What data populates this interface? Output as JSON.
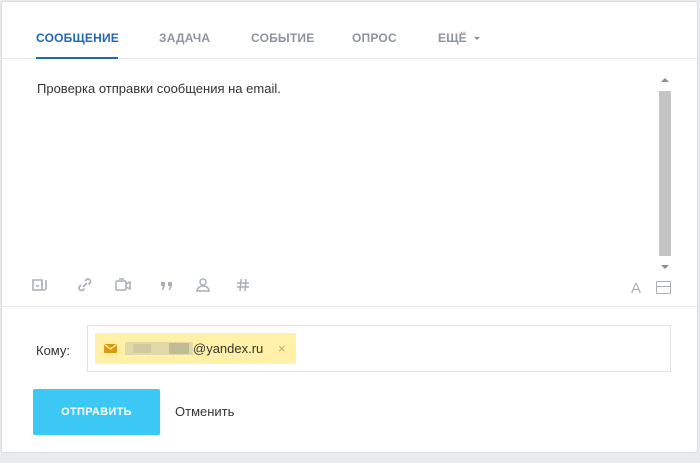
{
  "tabs": [
    {
      "label": "СООБЩЕНИЕ",
      "active": true
    },
    {
      "label": "ЗАДАЧА",
      "active": false
    },
    {
      "label": "СОБЫТИЕ",
      "active": false
    },
    {
      "label": "ОПРОС",
      "active": false
    },
    {
      "label": "ЕЩЁ",
      "active": false,
      "has_dropdown": true
    }
  ],
  "editor": {
    "text": "Проверка отправки сообщения на email."
  },
  "toolbar": {
    "icons": [
      "attach-file-icon",
      "link-icon",
      "video-icon",
      "quote-icon",
      "mention-user-icon",
      "hashtag-icon"
    ],
    "format_text_label": "A",
    "format_panel_icon": "panel-layout-icon"
  },
  "recipients": {
    "label": "Кому:",
    "chips": [
      {
        "email_visible": "@yandex.ru",
        "remove": "×",
        "icon": "mail-icon"
      }
    ]
  },
  "actions": {
    "send_label": "ОТПРАВИТЬ",
    "cancel_label": "Отменить"
  },
  "colors": {
    "accent": "#2067b0",
    "send_button": "#3bc8f5",
    "chip_bg": "#fff1a7"
  }
}
